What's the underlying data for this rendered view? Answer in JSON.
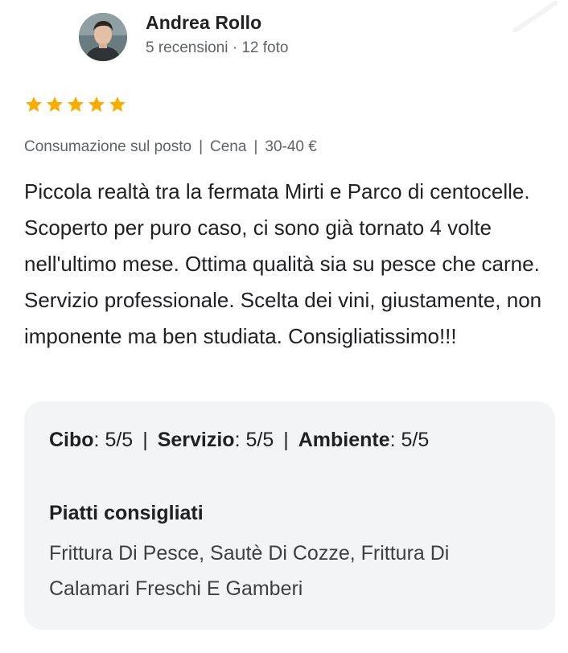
{
  "author": {
    "name": "Andrea Rollo",
    "meta": "5 recensioni · 12 foto",
    "avatar_icon": "user-avatar-photo"
  },
  "rating": {
    "stars": 5,
    "max": 5,
    "color": "#f9ab00"
  },
  "visit": {
    "type": "Consumazione sul posto",
    "meal": "Cena",
    "price": "30-40 €",
    "separator": "|"
  },
  "review_text": "Piccola realtà tra la fermata Mirti e Parco di centocelle. Scoperto per puro caso, ci sono già tornato 4 volte nell'ultimo mese. Ottima qualità sia su pesce che carne. Servizio professionale. Scelta dei vini, giustamente, non imponente ma ben studiata. Consigliatissimo!!!",
  "details": {
    "ratings": [
      {
        "label": "Cibo",
        "value": ": 5/5"
      },
      {
        "label": "Servizio",
        "value": ": 5/5"
      },
      {
        "label": "Ambiente",
        "value": ": 5/5"
      }
    ],
    "separator": "|",
    "dishes_title": "Piatti consigliati",
    "dishes": "Frittura Di Pesce, Sautè Di Cozze, Frittura Di Calamari Freschi E Gamberi"
  },
  "colors": {
    "text_primary": "#202124",
    "text_secondary": "#5f6368",
    "panel_bg": "#f3f4f6"
  }
}
